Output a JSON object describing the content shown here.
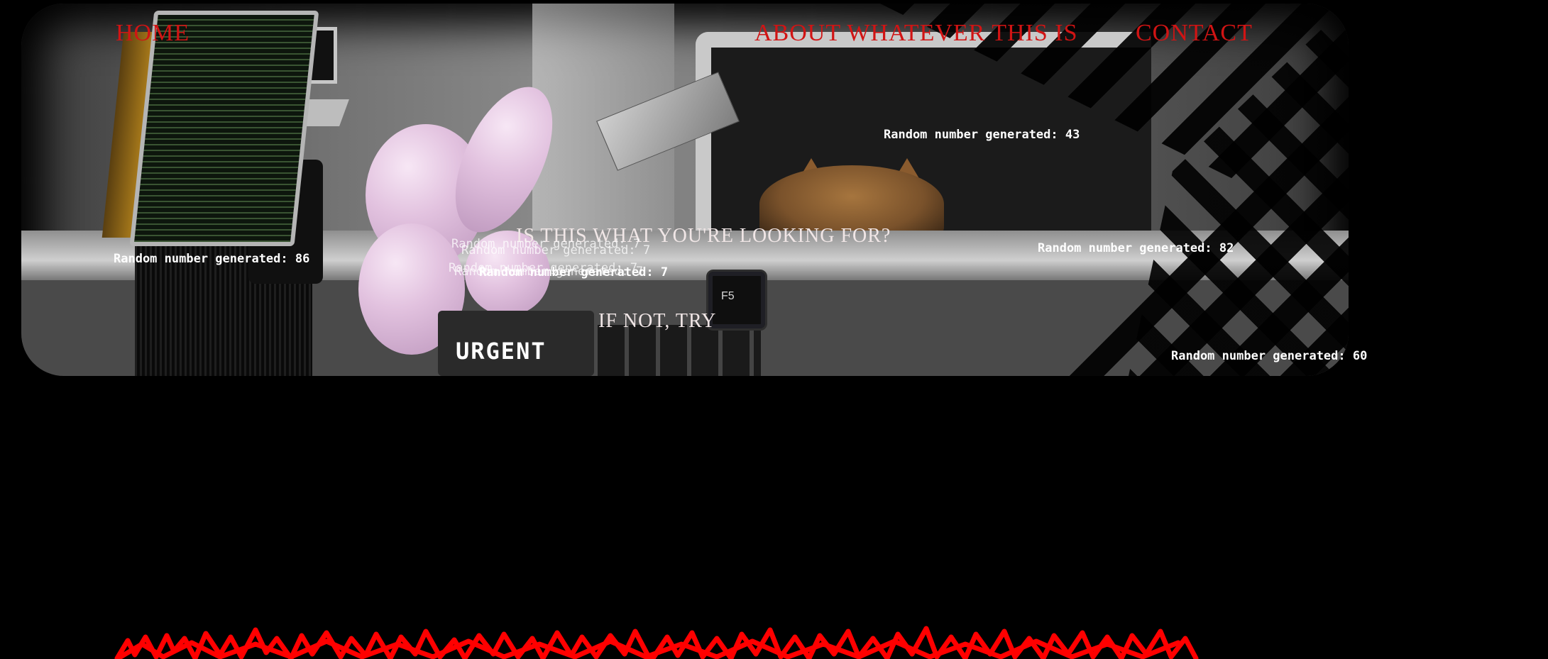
{
  "nav": {
    "home": "HOME",
    "about": "ABOUT WHATEVER THIS IS",
    "contact": "CONTACT"
  },
  "hero": {
    "question": "IS THIS WHAT YOU'RE LOOKING FOR?",
    "try_text": "IF NOT, TRY",
    "key_label": "F5",
    "urgent_label": "URGENT"
  },
  "random_numbers": [
    {
      "text": "Random number generated: 43"
    },
    {
      "text": "Random number generated: 86"
    },
    {
      "text": "Random number generated: 82"
    },
    {
      "text": "Random number generated: 60"
    },
    {
      "text": "Random number generated: 7"
    },
    {
      "text": "Random number generated: 7"
    },
    {
      "text": "Random number generated: 7"
    },
    {
      "text": "Random number generated: 7"
    },
    {
      "text": "Random number generated: 7"
    }
  ],
  "colors": {
    "nav_red": "#d11414",
    "scribble_red": "#ff0000",
    "background": "#000000"
  }
}
